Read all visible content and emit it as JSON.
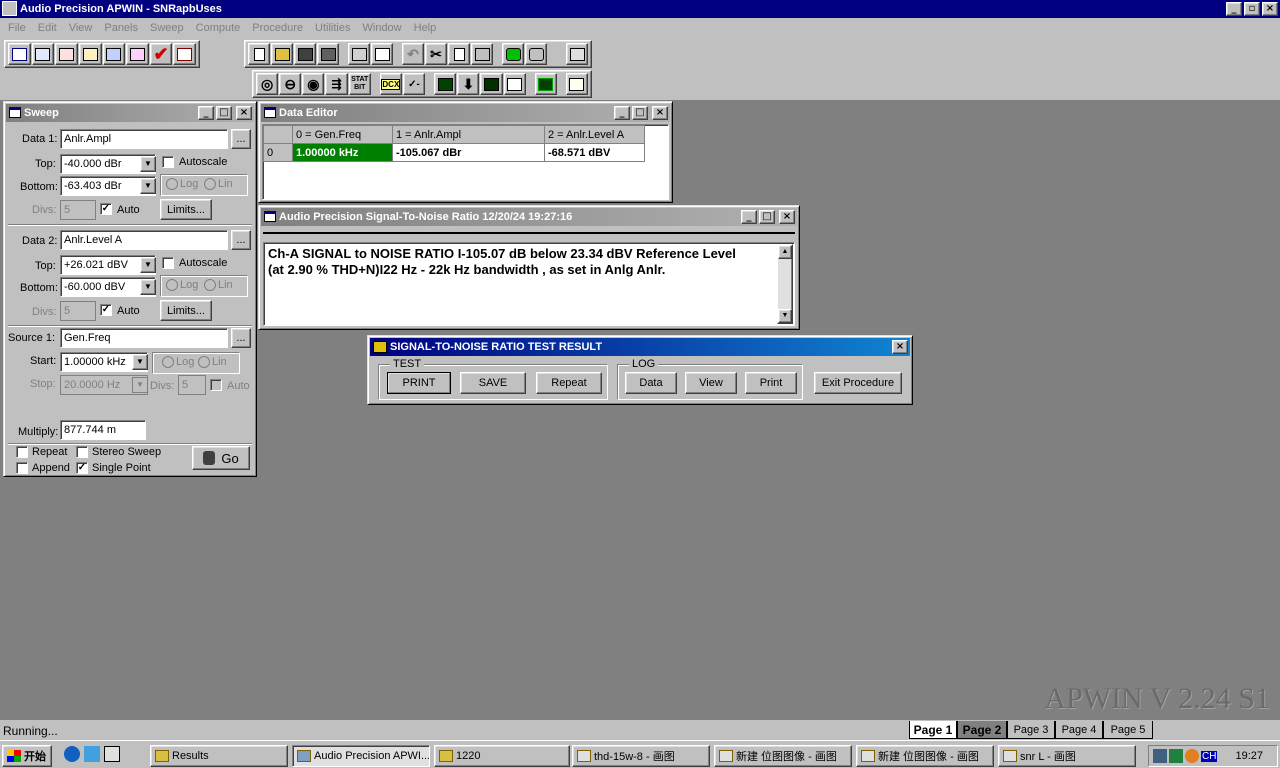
{
  "app": {
    "title": "Audio Precision APWIN - SNRapbUses",
    "watermark": "APWIN V 2.24  S1",
    "status": "Running..."
  },
  "menu": [
    "File",
    "Edit",
    "View",
    "Panels",
    "Sweep",
    "Compute",
    "Procedure",
    "Utilities",
    "Window",
    "Help"
  ],
  "toolbar": {
    "row1_left": [
      "sweep-graph",
      "THD",
      "SNR",
      "FFT",
      "bargraph",
      "MLS",
      "check",
      "list"
    ],
    "row1_mid": [
      "new",
      "open",
      "save",
      "save-all",
      "print",
      "print-preview",
      "undo",
      "cut",
      "copy",
      "paste",
      "go-green",
      "stop",
      "graph-settings"
    ],
    "row2": [
      "generator",
      "analyzer",
      "meter",
      "sweep-settings",
      "STAT BIT",
      "DCX",
      "switcher",
      "digital-io",
      "bar-down",
      "graph",
      "data-panel",
      "LED",
      "notes"
    ]
  },
  "sweep_panel": {
    "title": "Sweep",
    "data1": {
      "label": "Data 1:",
      "value": "Anlr.Ampl",
      "top_label": "Top:",
      "top": "-40.000  dBr",
      "bottom_label": "Bottom:",
      "bottom": "-63.403  dBr",
      "autoscale": "Autoscale",
      "log": "Log",
      "lin": "Lin",
      "divs_label": "Divs:",
      "divs": "5",
      "auto": "Auto",
      "limits": "Limits..."
    },
    "data2": {
      "label": "Data 2:",
      "value": "Anlr.Level A",
      "top_label": "Top:",
      "top": "+26.021  dBV",
      "bottom_label": "Bottom:",
      "bottom": "-60.000  dBV",
      "autoscale": "Autoscale",
      "log": "Log",
      "lin": "Lin",
      "divs_label": "Divs:",
      "divs": "5",
      "auto": "Auto",
      "limits": "Limits..."
    },
    "source1": {
      "label": "Source 1:",
      "value": "Gen.Freq",
      "start_label": "Start:",
      "start": "1.00000 kHz",
      "stop_label": "Stop:",
      "stop": "20.0000  Hz",
      "log": "Log",
      "lin": "Lin",
      "divs_label": "Divs:",
      "divs": "5",
      "auto": "Auto"
    },
    "browse": "...",
    "multiply_label": "Multiply:",
    "multiply": "877.744 m",
    "repeat": "Repeat",
    "stereo": "Stereo Sweep",
    "append": "Append",
    "single_point": "Single Point",
    "go": "Go"
  },
  "data_editor": {
    "title": "Data Editor",
    "headers": [
      "0 = Gen.Freq",
      "1 = Anlr.Ampl",
      "2 = Anlr.Level A"
    ],
    "rows": [
      {
        "index": "0",
        "cells": [
          "1.00000 kHz",
          "-105.067 dBr",
          "-68.571  dBV"
        ]
      }
    ]
  },
  "snr_window": {
    "title": "Audio Precision    Signal-To-Noise Ratio    12/20/24 19:27:16",
    "line1": "Ch-A SIGNAL to NOISE RATIO I-105.07 dB below 23.34 dBV  Reference Level",
    "line2": "(at 2.90 %  THD+N)I22 Hz - 22k Hz bandwidth , as set in Anlg Anlr."
  },
  "result_dialog": {
    "title": "SIGNAL-TO-NOISE RATIO TEST RESULT",
    "test_group": "TEST",
    "log_group": "LOG",
    "buttons_test": [
      "PRINT",
      "SAVE",
      "Repeat"
    ],
    "buttons_log": [
      "Data",
      "View",
      "Print"
    ],
    "exit": "Exit Procedure"
  },
  "pages": [
    "Page 1",
    "Page 2",
    "Page 3",
    "Page 4",
    "Page 5"
  ],
  "taskbar": {
    "start": "开始",
    "tasks": [
      "Results",
      "Audio Precision APWI...",
      "1220",
      "thd-15w-8 - 画图",
      "新建 位图图像 - 画图",
      "新建 位图图像 - 画图",
      "snr L - 画图"
    ],
    "lang": "CH",
    "clock": "19:27"
  }
}
